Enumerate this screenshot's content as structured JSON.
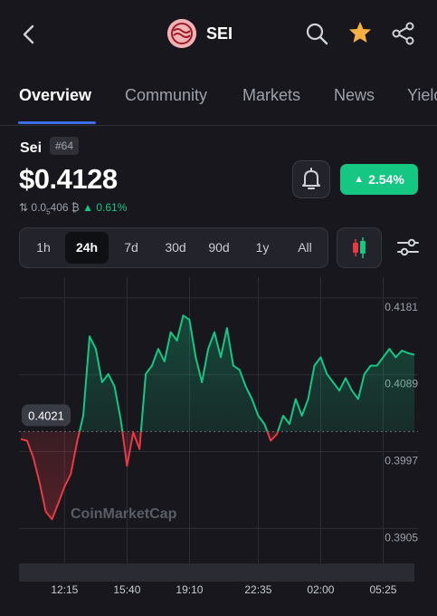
{
  "header": {
    "symbol": "SEI",
    "icons": [
      "back-arrow-icon",
      "search-icon",
      "star-icon",
      "share-icon"
    ],
    "star_color": "#f5b041"
  },
  "tabs": [
    {
      "label": "Overview",
      "active": true
    },
    {
      "label": "Community",
      "active": false
    },
    {
      "label": "Markets",
      "active": false
    },
    {
      "label": "News",
      "active": false
    },
    {
      "label": "Yield",
      "active": false
    }
  ],
  "coin": {
    "name": "Sei",
    "rank": "#64",
    "price": "$0.4128",
    "btc_price_prefix": "0.0",
    "btc_price_subscript": "5",
    "btc_price_suffix": "406 ₿",
    "btc_change": "0.61%",
    "change_24h": "2.54%"
  },
  "ranges": {
    "items": [
      "1h",
      "24h",
      "7d",
      "30d",
      "90d",
      "1y",
      "All"
    ],
    "selected": "24h"
  },
  "chart_data": {
    "type": "line",
    "title": "",
    "xlabel": "",
    "ylabel": "",
    "x_ticks": [
      "12:15",
      "15:40",
      "19:10",
      "22:35",
      "02:00",
      "05:25"
    ],
    "y_ticks": [
      0.4181,
      0.4089,
      0.3997,
      0.3905
    ],
    "ylim": [
      0.3875,
      0.4195
    ],
    "reference_price": 0.4021,
    "watermark": "CoinMarketCap",
    "colors": {
      "up": "#16c784",
      "down": "#ea3943",
      "grid": "#2d2f36"
    },
    "series": [
      {
        "x": [
          "10:00",
          "10:20",
          "10:40",
          "11:00",
          "11:20",
          "11:40",
          "12:00",
          "12:20",
          "12:40",
          "13:00",
          "13:20",
          "13:40",
          "14:00",
          "14:20",
          "14:40",
          "15:00",
          "15:20",
          "15:40",
          "16:00",
          "16:20",
          "16:40",
          "17:00",
          "17:20",
          "17:40",
          "18:00",
          "18:20",
          "18:40",
          "19:00",
          "19:20",
          "19:40",
          "20:00",
          "20:20",
          "20:40",
          "21:00",
          "21:20",
          "21:40",
          "22:00",
          "22:20",
          "22:40",
          "23:00",
          "23:20",
          "23:40",
          "00:00",
          "00:20",
          "00:40",
          "01:00",
          "01:20",
          "01:40",
          "02:00",
          "02:20",
          "02:40",
          "03:00",
          "03:20",
          "03:40",
          "04:00",
          "04:20",
          "04:40",
          "05:00",
          "05:20",
          "05:40",
          "06:00",
          "06:20",
          "06:40",
          "07:00"
        ],
        "values": [
          0.4012,
          0.401,
          0.399,
          0.396,
          0.3925,
          0.3916,
          0.3935,
          0.3955,
          0.397,
          0.4008,
          0.404,
          0.4135,
          0.412,
          0.408,
          0.409,
          0.4075,
          0.4035,
          0.398,
          0.402,
          0.4,
          0.409,
          0.41,
          0.412,
          0.4105,
          0.414,
          0.413,
          0.416,
          0.4155,
          0.411,
          0.408,
          0.412,
          0.414,
          0.411,
          0.4145,
          0.41,
          0.4095,
          0.4075,
          0.406,
          0.404,
          0.403,
          0.401,
          0.4018,
          0.404,
          0.403,
          0.406,
          0.404,
          0.406,
          0.41,
          0.411,
          0.409,
          0.408,
          0.407,
          0.4085,
          0.407,
          0.406,
          0.409,
          0.41,
          0.41,
          0.411,
          0.412,
          0.411,
          0.4118,
          0.4115,
          0.4113
        ]
      }
    ]
  }
}
